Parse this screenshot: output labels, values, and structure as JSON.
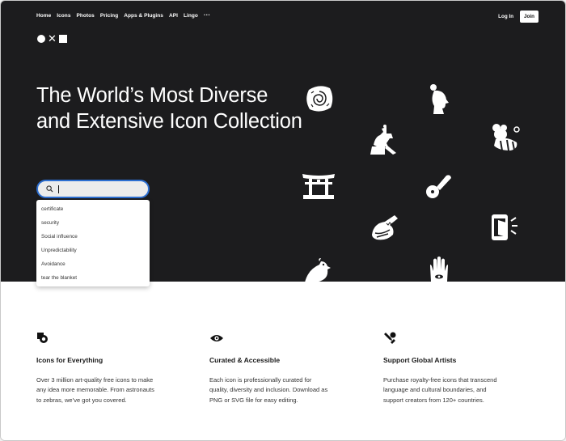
{
  "nav": {
    "items": [
      "Home",
      "Icons",
      "Photos",
      "Pricing",
      "Apps & Plugins",
      "API",
      "Lingo",
      "···"
    ],
    "login": "Log In",
    "join": "Join"
  },
  "hero": {
    "headline": "The World’s Most Diverse and Extensive Icon Collection",
    "search": {
      "value": "",
      "placeholder": ""
    },
    "suggestions": [
      "certificate",
      "security",
      "Social influence",
      "Unpredictability",
      "Avoidance",
      "tear the blanket"
    ],
    "icons": [
      "brain-stone-icon",
      "woman-profile-icon",
      "statue-horse-rider-icon",
      "mouse-bee-costume-icon",
      "torii-gate-icon",
      "pizza-cutter-icon",
      "crocodile-icon",
      "phone-door-icon",
      "quail-icon",
      "hamsa-hand-icon"
    ]
  },
  "features": [
    {
      "icon": "shapes-icon",
      "title": "Icons for Everything",
      "desc": "Over 3 million art-quality free icons to make any idea more memorable. From astronauts to zebras, we’ve got you covered."
    },
    {
      "icon": "eye-icon",
      "title": "Curated & Accessible",
      "desc": "Each icon is professionally curated for quality, diversity and inclusion. Download as PNG or SVG file for easy editing."
    },
    {
      "icon": "pen-tools-icon",
      "title": "Support Global Artists",
      "desc": "Purchase royalty-free icons that transcend language and cultural boundaries, and support creators from 120+ countries."
    }
  ],
  "colors": {
    "hero_bg": "#1c1c1e",
    "accent": "#2d6fd1"
  }
}
